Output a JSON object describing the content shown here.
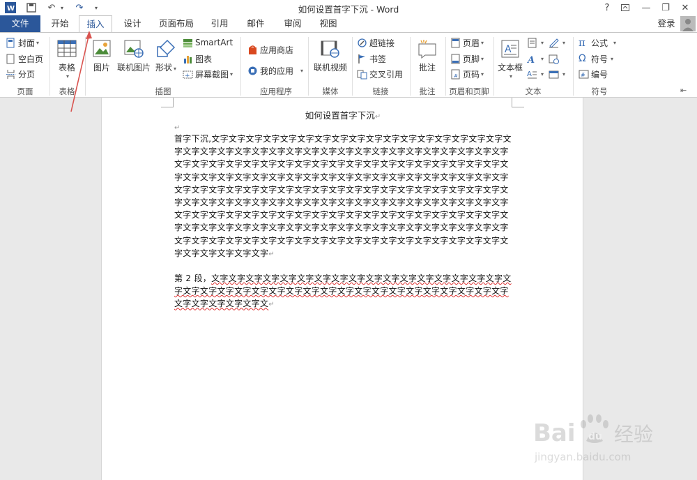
{
  "window": {
    "title": "如何设置首字下沉 - Word",
    "help_label": "?",
    "minimize_label": "—",
    "restore_label": "❐",
    "close_label": "✕",
    "login_label": "登录"
  },
  "quick_access": {
    "word_icon": "word-logo-icon",
    "save_icon": "save-icon",
    "undo_icon": "undo-icon",
    "redo_icon": "redo-icon",
    "customize_icon": "customize-icon"
  },
  "tabs": [
    {
      "label": "文件"
    },
    {
      "label": "开始"
    },
    {
      "label": "插入"
    },
    {
      "label": "设计"
    },
    {
      "label": "页面布局"
    },
    {
      "label": "引用"
    },
    {
      "label": "邮件"
    },
    {
      "label": "审阅"
    },
    {
      "label": "视图"
    }
  ],
  "ribbon": {
    "pages": {
      "cover": "封面",
      "blank": "空白页",
      "break": "分页",
      "label": "页面"
    },
    "tables": {
      "table": "表格",
      "label": "表格"
    },
    "illustrations": {
      "picture": "图片",
      "online_picture": "联机图片",
      "shapes": "形状",
      "smartart": "SmartArt",
      "chart": "图表",
      "screenshot": "屏幕截图",
      "label": "插图"
    },
    "apps": {
      "store": "应用商店",
      "my_apps": "我的应用",
      "label": "应用程序"
    },
    "media": {
      "online_video": "联机视频",
      "label": "媒体"
    },
    "links": {
      "hyperlink": "超链接",
      "bookmark": "书签",
      "cross_ref": "交叉引用",
      "label": "链接"
    },
    "comments": {
      "comment": "批注",
      "label": "批注"
    },
    "header_footer": {
      "header": "页眉",
      "footer": "页脚",
      "page_number": "页码",
      "label": "页眉和页脚"
    },
    "text": {
      "textbox": "文本框",
      "label": "文本"
    },
    "symbols": {
      "equation": "公式",
      "symbol": "符号",
      "numbering": "编号",
      "label": "符号"
    }
  },
  "document": {
    "title": "如何设置首字下沉",
    "para1": "首字下沉,文字文字文字文字文字文字文字文字文字文字文字文字文字文字文字文字文字文字文字文字文字文字文字文字文字文字文字文字文字文字文字文字文字文字文字文字文字文字文字文字文字文字文字文字文字文字文字文字文字文字文字文字文字文字文字文字文字文字文字文字文字文字文字文字文字文字文字文字文字文字文字文字文字文字文字文字文字文字文字文字文字文字文字文字文字文字文字文字文字文字文字文字文字文字文字文字文字文字文字文字文字文字文字文字文字文字文字文字文字文字文字文字文字文字文字文字文字文字文字文字文字文字文字文字文字文字文字文字文字文字文字文字文字文字文字文字文字文字文字文字文字文字文字文字文字文字文字文字文字文字文字文字文字文字文字文字文字文字文字文字文字文字文字文字文字文字文字文字文字文字文字文字文字文字文字文字文字文字文字",
    "para2_prefix": "第 2 段，",
    "para2_body": "文字文字文字文字文字文字文字文字文字文字文字文字文字文字文字文字文字文字文字文字文字文字文字文字文字文字文字文字文字文字文字文字文字文字文字文字文字文字文字文字文字文字文",
    "para_mark": "↵"
  },
  "watermark": {
    "brand": "Bai du 经验",
    "url": "jingyan.baidu.com"
  },
  "colors": {
    "file_tab": "#2b579a",
    "accent": "#2b579a",
    "annotation_arrow": "#d9534f"
  }
}
